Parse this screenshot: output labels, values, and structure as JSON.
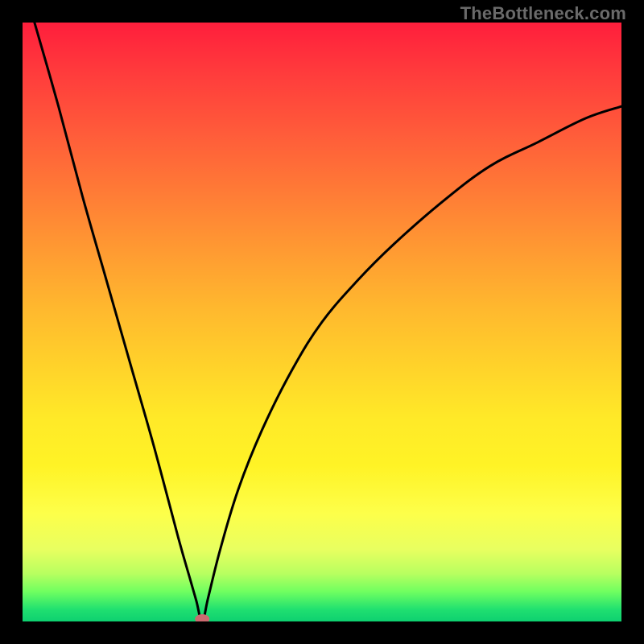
{
  "watermark": "TheBottleneck.com",
  "chart_data": {
    "type": "line",
    "title": "",
    "xlabel": "",
    "ylabel": "",
    "xlim": [
      0,
      100
    ],
    "ylim": [
      0,
      100
    ],
    "grid": false,
    "legend": false,
    "curve_min_x": 30,
    "marker": {
      "x": 30,
      "y": 0,
      "color": "#cc6a70"
    },
    "series": [
      {
        "name": "bottleneck-curve",
        "x": [
          2,
          6,
          10,
          14,
          18,
          22,
          26,
          28,
          29,
          30,
          31,
          33,
          36,
          40,
          45,
          50,
          56,
          62,
          70,
          78,
          86,
          94,
          100
        ],
        "values": [
          100,
          86,
          71,
          57,
          43,
          29,
          14,
          7,
          3.5,
          0,
          4,
          12,
          22,
          32,
          42,
          50,
          57,
          63,
          70,
          76,
          80,
          84,
          86
        ]
      }
    ]
  }
}
